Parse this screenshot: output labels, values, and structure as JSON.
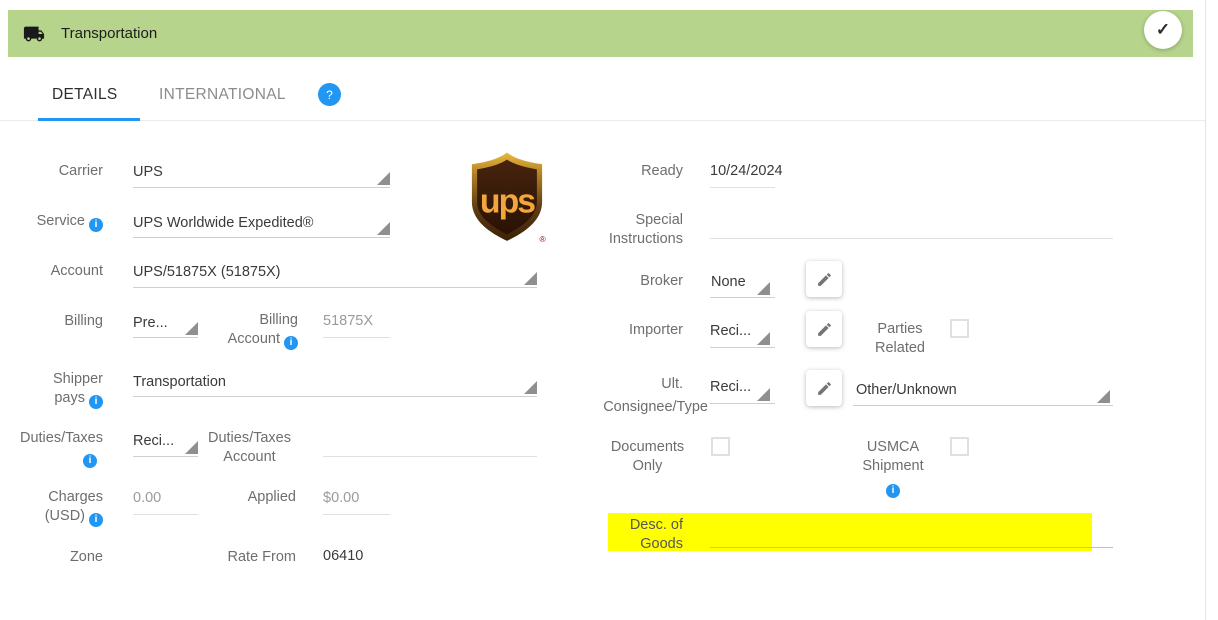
{
  "header": {
    "title": "Transportation",
    "check": "✓"
  },
  "tabs": {
    "details": "DETAILS",
    "international": "INTERNATIONAL",
    "help": "?"
  },
  "form": {
    "carrier": {
      "label": "Carrier",
      "value": "UPS"
    },
    "service": {
      "label": "Service",
      "value": "UPS Worldwide Expedited®"
    },
    "account": {
      "label": "Account",
      "value": "UPS/51875X (51875X)"
    },
    "billing": {
      "label": "Billing",
      "value": "Pre..."
    },
    "billing_account": {
      "label1": "Billing",
      "label2": "Account",
      "value": "51875X"
    },
    "shipper_pays": {
      "label1": "Shipper",
      "label2": "pays",
      "value": "Transportation"
    },
    "duties_taxes": {
      "label": "Duties/Taxes",
      "value": "Reci..."
    },
    "duties_taxes_account": {
      "label1": "Duties/Taxes",
      "label2": "Account",
      "value": ""
    },
    "charges": {
      "label1": "Charges",
      "label2": "(USD)",
      "value": "0.00"
    },
    "applied": {
      "label": "Applied",
      "value": "$0.00"
    },
    "zone": {
      "label": "Zone",
      "value": ""
    },
    "rate_from": {
      "label": "Rate From",
      "value": "06410"
    },
    "ready": {
      "label": "Ready",
      "value": "10/24/2024"
    },
    "special_instructions": {
      "label1": "Special",
      "label2": "Instructions",
      "value": ""
    },
    "broker": {
      "label": "Broker",
      "value": "None"
    },
    "importer": {
      "label": "Importer",
      "value": "Reci..."
    },
    "parties_related": {
      "label1": "Parties",
      "label2": "Related",
      "checked": false
    },
    "ult_consignee": {
      "label1": "Ult.",
      "label2": "Consignee/Type",
      "value": "Reci..."
    },
    "consignee_type": {
      "value": "Other/Unknown"
    },
    "documents_only": {
      "label1": "Documents",
      "label2": "Only",
      "checked": false
    },
    "usmca": {
      "label1": "USMCA",
      "label2": "Shipment",
      "checked": false
    },
    "desc_of_goods": {
      "label1": "Desc. of",
      "label2": "Goods",
      "value": ""
    }
  },
  "logo": {
    "text": "ups",
    "registered": "®"
  },
  "colors": {
    "header_green": "#b6d48b",
    "accent_blue": "#2196f3",
    "highlight_yellow": "#ffff00",
    "ups_gold": "#f2a63b",
    "ups_brown": "#33190a"
  }
}
